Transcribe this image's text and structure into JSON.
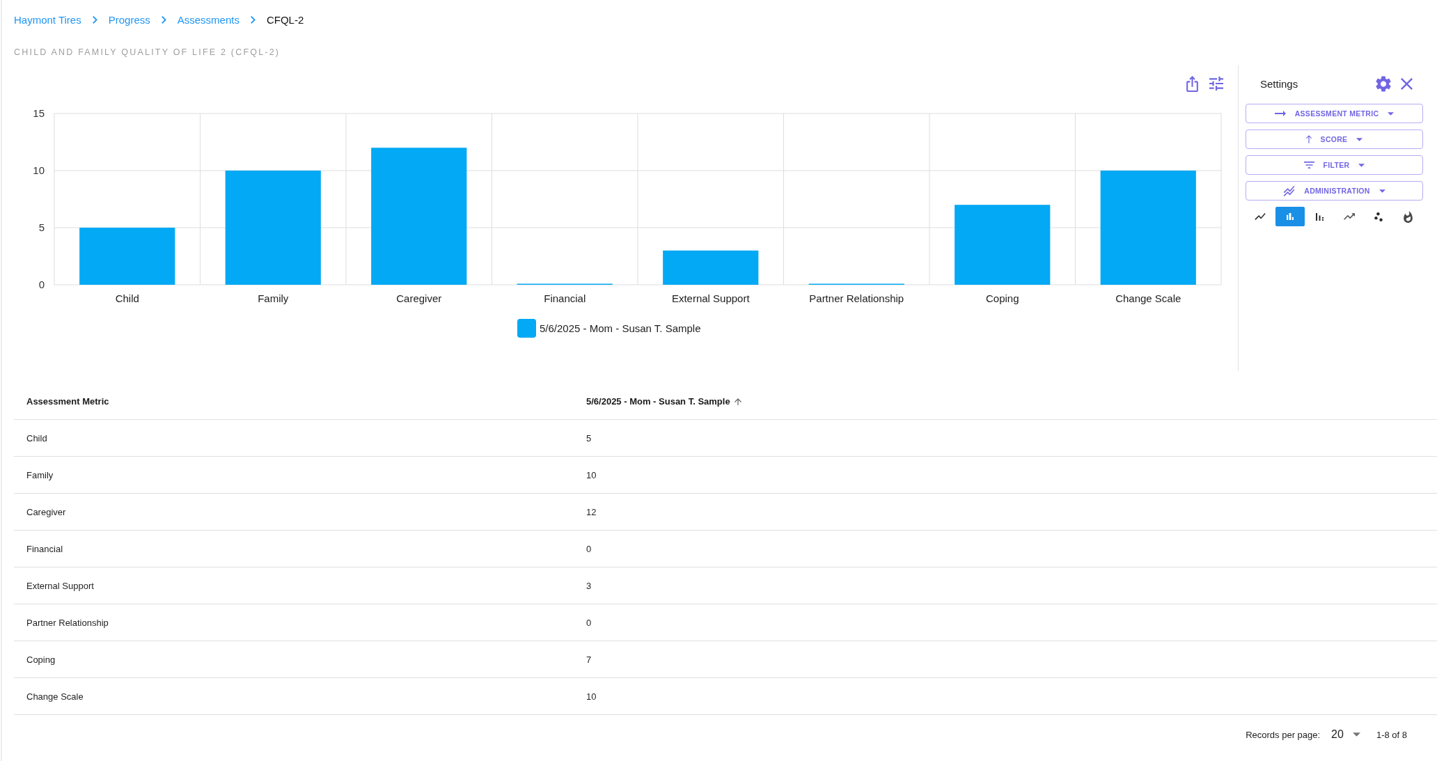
{
  "breadcrumb": [
    {
      "label": "Haymont Tires",
      "current": false
    },
    {
      "label": "Progress",
      "current": false
    },
    {
      "label": "Assessments",
      "current": false
    },
    {
      "label": "CFQL-2",
      "current": true
    }
  ],
  "page_title": "CHILD AND FAMILY QUALITY OF LIFE 2 (CFQL-2)",
  "chart": {
    "chart_data": {
      "type": "bar",
      "categories": [
        "Child",
        "Family",
        "Caregiver",
        "Financial",
        "External Support",
        "Partner Relationship",
        "Coping",
        "Change Scale"
      ],
      "series": [
        {
          "name": "5/6/2025 - Mom - Susan T. Sample",
          "color": "#03a9f4",
          "values": [
            5,
            10,
            12,
            0,
            3,
            0,
            7,
            10
          ]
        }
      ],
      "ylim": [
        0,
        15
      ],
      "yticks": [
        0,
        5,
        10,
        15
      ]
    }
  },
  "settings": {
    "title": "Settings",
    "dropdowns": [
      {
        "label": "ASSESSMENT METRIC"
      },
      {
        "label": "SCORE"
      },
      {
        "label": "FILTER"
      },
      {
        "label": "ADMINISTRATION"
      }
    ],
    "chart_types": [
      {
        "selected": false
      },
      {
        "selected": true
      },
      {
        "selected": false
      },
      {
        "selected": false
      },
      {
        "selected": false
      },
      {
        "selected": false
      }
    ]
  },
  "table": {
    "columns": [
      {
        "label": "Assessment Metric",
        "sorted": false
      },
      {
        "label": "5/6/2025 - Mom - Susan T. Sample",
        "sorted": true
      }
    ],
    "rows": [
      {
        "cells": [
          "Child",
          "5"
        ]
      },
      {
        "cells": [
          "Family",
          "10"
        ]
      },
      {
        "cells": [
          "Caregiver",
          "12"
        ]
      },
      {
        "cells": [
          "Financial",
          "0"
        ]
      },
      {
        "cells": [
          "External Support",
          "3"
        ]
      },
      {
        "cells": [
          "Partner Relationship",
          "0"
        ]
      },
      {
        "cells": [
          "Coping",
          "7"
        ]
      },
      {
        "cells": [
          "Change Scale",
          "10"
        ]
      }
    ]
  },
  "pagination": {
    "label": "Records per page:",
    "per_page": "20",
    "range": "1-8 of 8"
  }
}
